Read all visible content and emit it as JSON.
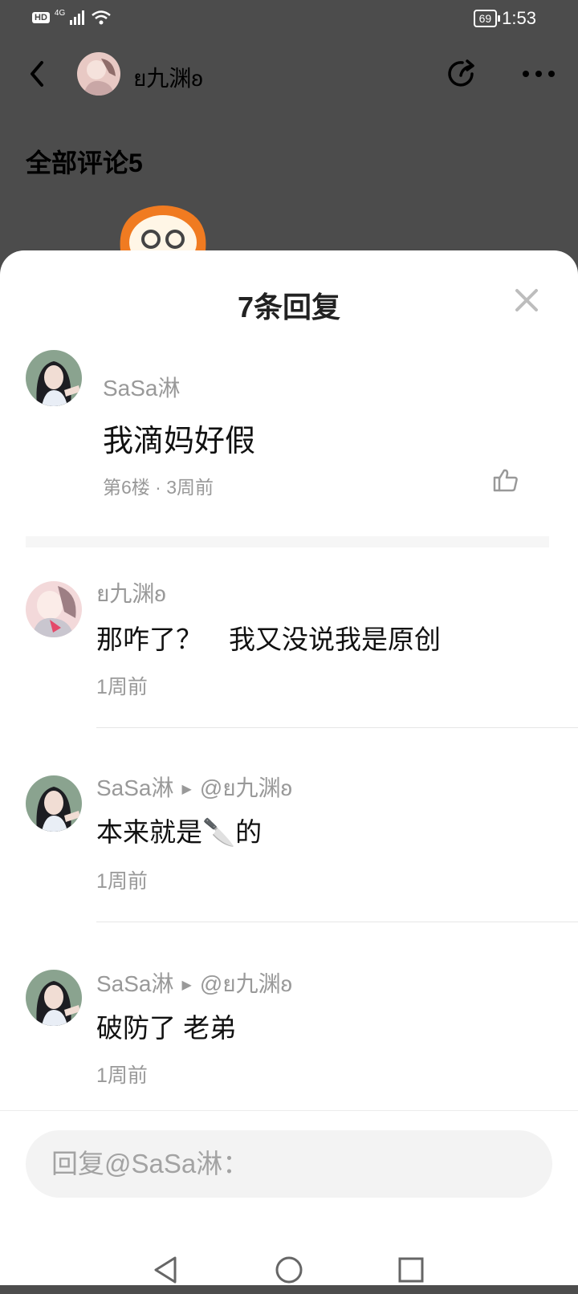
{
  "status_bar": {
    "hd": "HD",
    "network": "4G",
    "battery": "69",
    "time": "1:53",
    "icons": [
      "signal-icon",
      "wifi-icon",
      "battery-icon"
    ]
  },
  "header": {
    "username": "ย九渊ʚ",
    "icons": [
      "back-arrow-icon",
      "share-icon",
      "more-icon"
    ]
  },
  "comments_section": {
    "title": "全部评论5"
  },
  "sheet": {
    "title": "7条回复",
    "close_icon": "close-icon",
    "root_comment": {
      "name": "SaSa淋",
      "text": "我滴妈好假",
      "meta": "第6楼 · 3周前",
      "like_icon": "thumbs-up-icon"
    },
    "replies": [
      {
        "name": "ย九渊ʚ",
        "target": "",
        "text": "那咋了？　我又没说我是原创",
        "time": "1周前"
      },
      {
        "name": "SaSa淋",
        "target": "@ย九渊ʚ",
        "text": "本来就是🔪的",
        "time": "1周前"
      },
      {
        "name": "SaSa淋",
        "target": "@ย九渊ʚ",
        "text": "破防了 老弟",
        "time": "1周前"
      }
    ],
    "reply_input": {
      "placeholder": "回复@SaSa淋："
    }
  },
  "nav_bar": {
    "icons": [
      "nav-back-icon",
      "nav-home-icon",
      "nav-recent-icon"
    ]
  },
  "colors": {
    "dim_overlay": "#000000",
    "text_primary": "#111111",
    "text_secondary": "#999999",
    "divider": "#e6e6e6",
    "input_bg": "#f3f3f3"
  }
}
